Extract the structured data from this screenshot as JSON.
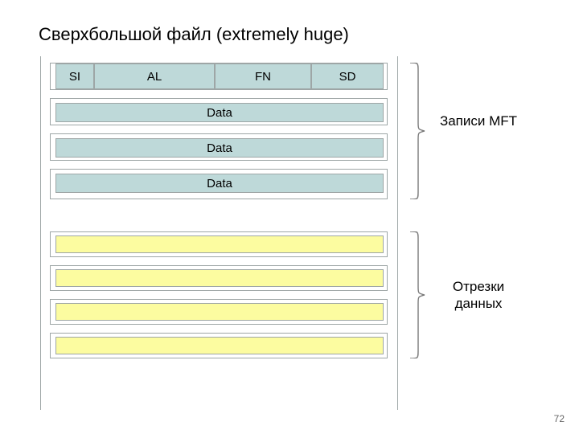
{
  "title": "Сверхбольшой файл (extremely huge)",
  "page_number": "72",
  "mft": {
    "header": {
      "si": "SI",
      "al": "AL",
      "fn": "FN",
      "sd": "SD"
    },
    "data_rows": [
      "Data",
      "Data",
      "Data"
    ],
    "brace_label": "Записи MFT"
  },
  "runs": {
    "brace_label": "Отрезки данных"
  },
  "colors": {
    "blue": "#bed9d9",
    "yellow": "#fcfca0",
    "line": "#9ea6a6"
  }
}
